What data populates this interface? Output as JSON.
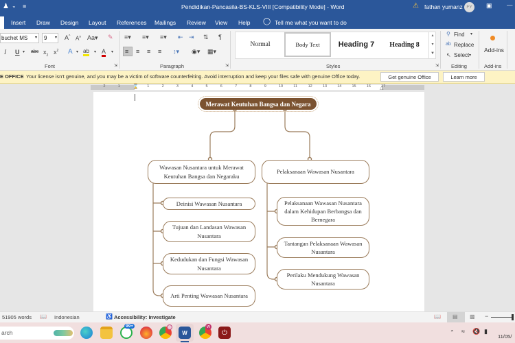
{
  "titlebar": {
    "title": "Pendidikan-Pancasila-BS-KLS-VIII [Compatibility Mode]  -  Word",
    "user_name": "fathan yumanz",
    "user_initials": "FY",
    "warning_icon": "warning-icon",
    "minimize": "—"
  },
  "tabs": [
    "Insert",
    "Draw",
    "Design",
    "Layout",
    "References",
    "Mailings",
    "Review",
    "View",
    "Help"
  ],
  "tell_me": "Tell me what you want to do",
  "ribbon": {
    "font": {
      "name": "buchet MS",
      "size": "9",
      "label": "Font"
    },
    "paragraph_label": "Paragraph",
    "styles": {
      "items": [
        "Normal",
        "Body Text",
        "Heading 7",
        "Heading 8"
      ],
      "label": "Styles"
    },
    "editing": {
      "find": "Find",
      "replace": "Replace",
      "select": "Select",
      "label": "Editing"
    },
    "addins": {
      "button": "Add-ins",
      "label": "Add-ins"
    }
  },
  "message_bar": {
    "title": "E OFFICE",
    "text": "Your license isn't genuine, and you may be a victim of software counterfeiting. Avoid interruption and keep your files safe with genuine Office today.",
    "btn_primary": "Get genuine Office",
    "btn_secondary": "Learn more"
  },
  "ruler": {
    "left_ticks": [
      "2",
      "1"
    ],
    "ticks": [
      "1",
      "2",
      "3",
      "4",
      "5",
      "6",
      "7",
      "8",
      "9",
      "10",
      "11",
      "12",
      "13",
      "14",
      "15",
      "16",
      "17"
    ]
  },
  "mindmap": {
    "root": "Merawat Keutuhan Bangsa dan Negara",
    "branches": [
      {
        "title": "Wawasan Nusantara untuk Merawat Keutuhan Bangsa dan Negaraku",
        "children": [
          "Deinisi Wawasan Nusantara",
          "Tujuan dan Landasan Wawasan Nusantara",
          "Kedudukan dan Fungsi Wawasan Nusantara",
          "Arti Penting Wawasan Nusantara"
        ]
      },
      {
        "title": "Pelaksanaan Wawasan Nusantara",
        "children": [
          "Pelaksanaan Wawasan Nusantara dalam Kehidupan Berbangsa dan Bernegara",
          "Tantangan Pelaksanaan Wawasan Nusantara",
          "Perilaku Mendukung Wawasan Nusantara"
        ]
      }
    ]
  },
  "statusbar": {
    "words": "51905 words",
    "language": "Indonesian",
    "accessibility": "Accessibility: Investigate"
  },
  "taskbar": {
    "search": "arch",
    "whatsapp_badge": "99+",
    "chrome_badge": "W",
    "date": "11/05/"
  },
  "colors": {
    "word_blue": "#2b579a",
    "node_brown": "#7b5230",
    "node_border": "#9a7b5a",
    "msg_bar": "#fdf3c4"
  }
}
